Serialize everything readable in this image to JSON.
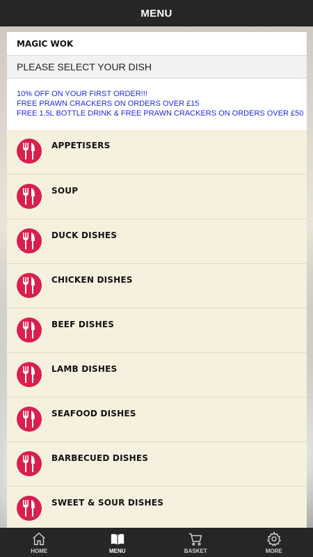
{
  "header": {
    "title": "MENU"
  },
  "restaurant": {
    "name": "MAGIC WOK"
  },
  "prompt": {
    "text": "PLEASE SELECT YOUR DISH"
  },
  "promo": {
    "lines": [
      "10% OFF ON YOUR FIRST ORDER!!!",
      "FREE PRAWN CRACKERS ON ORDERS OVER £15",
      "FREE 1.5L BOTTLE DRINK & FREE PRAWN CRACKERS ON ORDERS OVER £50"
    ],
    "color": "#1d2bd8"
  },
  "categories": [
    {
      "label": "APPETISERS",
      "icon": "fork-knife-icon"
    },
    {
      "label": "SOUP",
      "icon": "fork-knife-icon"
    },
    {
      "label": "DUCK DISHES",
      "icon": "fork-knife-icon"
    },
    {
      "label": "CHICKEN DISHES",
      "icon": "fork-knife-icon"
    },
    {
      "label": "BEEF DISHES",
      "icon": "fork-knife-icon"
    },
    {
      "label": "LAMB DISHES",
      "icon": "fork-knife-icon"
    },
    {
      "label": "SEAFOOD DISHES",
      "icon": "fork-knife-icon"
    },
    {
      "label": "BARBECUED DISHES",
      "icon": "fork-knife-icon"
    },
    {
      "label": "SWEET & SOUR DISHES",
      "icon": "fork-knife-icon"
    }
  ],
  "tabs": [
    {
      "label": "HOME",
      "icon": "home-icon",
      "active": false
    },
    {
      "label": "MENU",
      "icon": "book-icon",
      "active": true
    },
    {
      "label": "BASKET",
      "icon": "cart-icon",
      "active": false
    },
    {
      "label": "MORE",
      "icon": "gear-icon",
      "active": false
    }
  ],
  "colors": {
    "bar": "#262626",
    "panel": "#f6f1de",
    "accent": "#d81f4e"
  }
}
